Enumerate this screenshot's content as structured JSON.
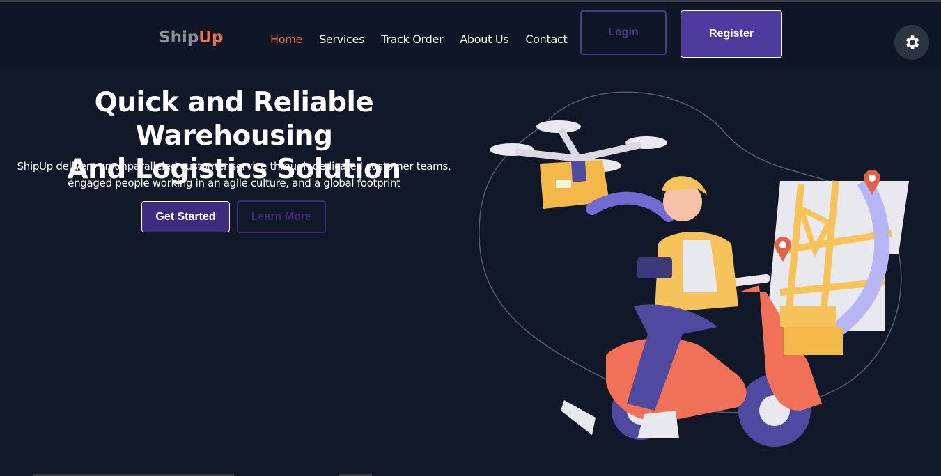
{
  "brand": {
    "part1": "Ship",
    "part2": "Up"
  },
  "nav": [
    {
      "label": "Home",
      "active": true
    },
    {
      "label": "Services"
    },
    {
      "label": "Track Order"
    },
    {
      "label": "About Us"
    },
    {
      "label": "Contact"
    }
  ],
  "auth": {
    "login": "Login",
    "register": "Register"
  },
  "settings_icon": "gear-icon",
  "hero": {
    "title_line1": "Quick and Reliable Warehousing",
    "title_line2": "And Logistics Solution",
    "lead_line1": "ShipUp delivers an unparalleled customer service through dedicated customer teams,",
    "lead_line2": "engaged people working in an agile culture, and a global footprint",
    "cta_primary": "Get Started",
    "cta_secondary": "Learn More"
  },
  "colors": {
    "background": "#111827",
    "accent": "#ef6f52",
    "primary": "#4c3a9e"
  }
}
